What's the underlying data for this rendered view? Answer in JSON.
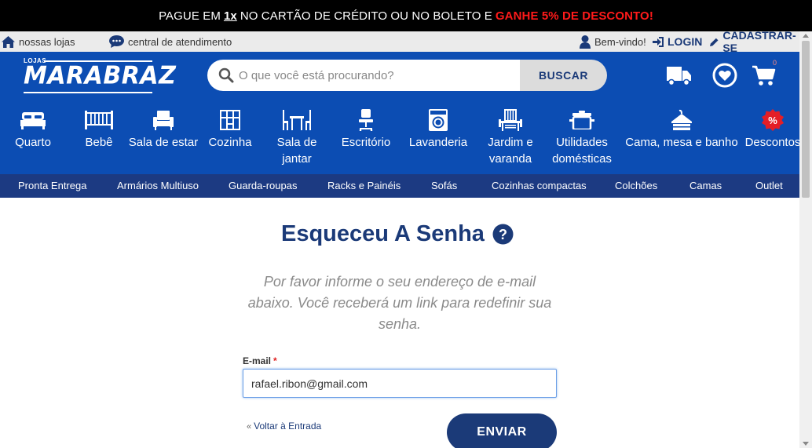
{
  "promo": {
    "part1": "PAGUE EM",
    "bold": "1x",
    "part2": "NO CARTÃO DE CRÉDITO OU NO BOLETO E",
    "highlight": "GANHE 5% DE DESCONTO!",
    "highlight_color": "#ff1a1a"
  },
  "topbar": {
    "stores": "nossas lojas",
    "support": "central de atendimento",
    "welcome": "Bem-vindo!",
    "login": "LOGIN",
    "register": "CADASTRAR-SE"
  },
  "header": {
    "logo_small": "LOJAS",
    "logo": "MARABRAZ",
    "search_placeholder": "O que você está procurando?",
    "search_button": "BUSCAR",
    "cart_count": "0",
    "brand_color": "#0c4db3"
  },
  "categories": [
    {
      "label": "Quarto",
      "icon": "bed-icon"
    },
    {
      "label": "Bebê",
      "icon": "crib-icon"
    },
    {
      "label": "Sala de estar",
      "icon": "armchair-icon"
    },
    {
      "label": "Cozinha",
      "icon": "kitchen-cabinet-icon"
    },
    {
      "label": "Sala de jantar",
      "icon": "dining-table-icon"
    },
    {
      "label": "Escritório",
      "icon": "office-chair-icon"
    },
    {
      "label": "Lavanderia",
      "icon": "washing-machine-icon"
    },
    {
      "label": "Jardim e varanda",
      "icon": "garden-bench-icon"
    },
    {
      "label": "Utilidades domésticas",
      "icon": "pot-icon"
    },
    {
      "label": "Cama, mesa e banho",
      "icon": "hanger-icon"
    },
    {
      "label": "Descontos",
      "icon": "discount-badge-icon"
    }
  ],
  "subnav": [
    "Pronta Entrega",
    "Armários Multiuso",
    "Guarda-roupas",
    "Racks e Painéis",
    "Sofás",
    "Cozinhas compactas",
    "Colchões",
    "Camas",
    "Outlet"
  ],
  "form": {
    "title": "Esqueceu A Senha",
    "description": "Por favor informe o seu endereço de e-mail abaixo. Você receberá um link para redefinir sua senha.",
    "email_label": "E-mail",
    "required_mark": "*",
    "email_value": "rafael.ribon@gmail.com",
    "back_arrow": "«",
    "back_link": "Voltar à Entrada",
    "submit": "ENVIAR",
    "accent_color": "#1b3a78"
  }
}
